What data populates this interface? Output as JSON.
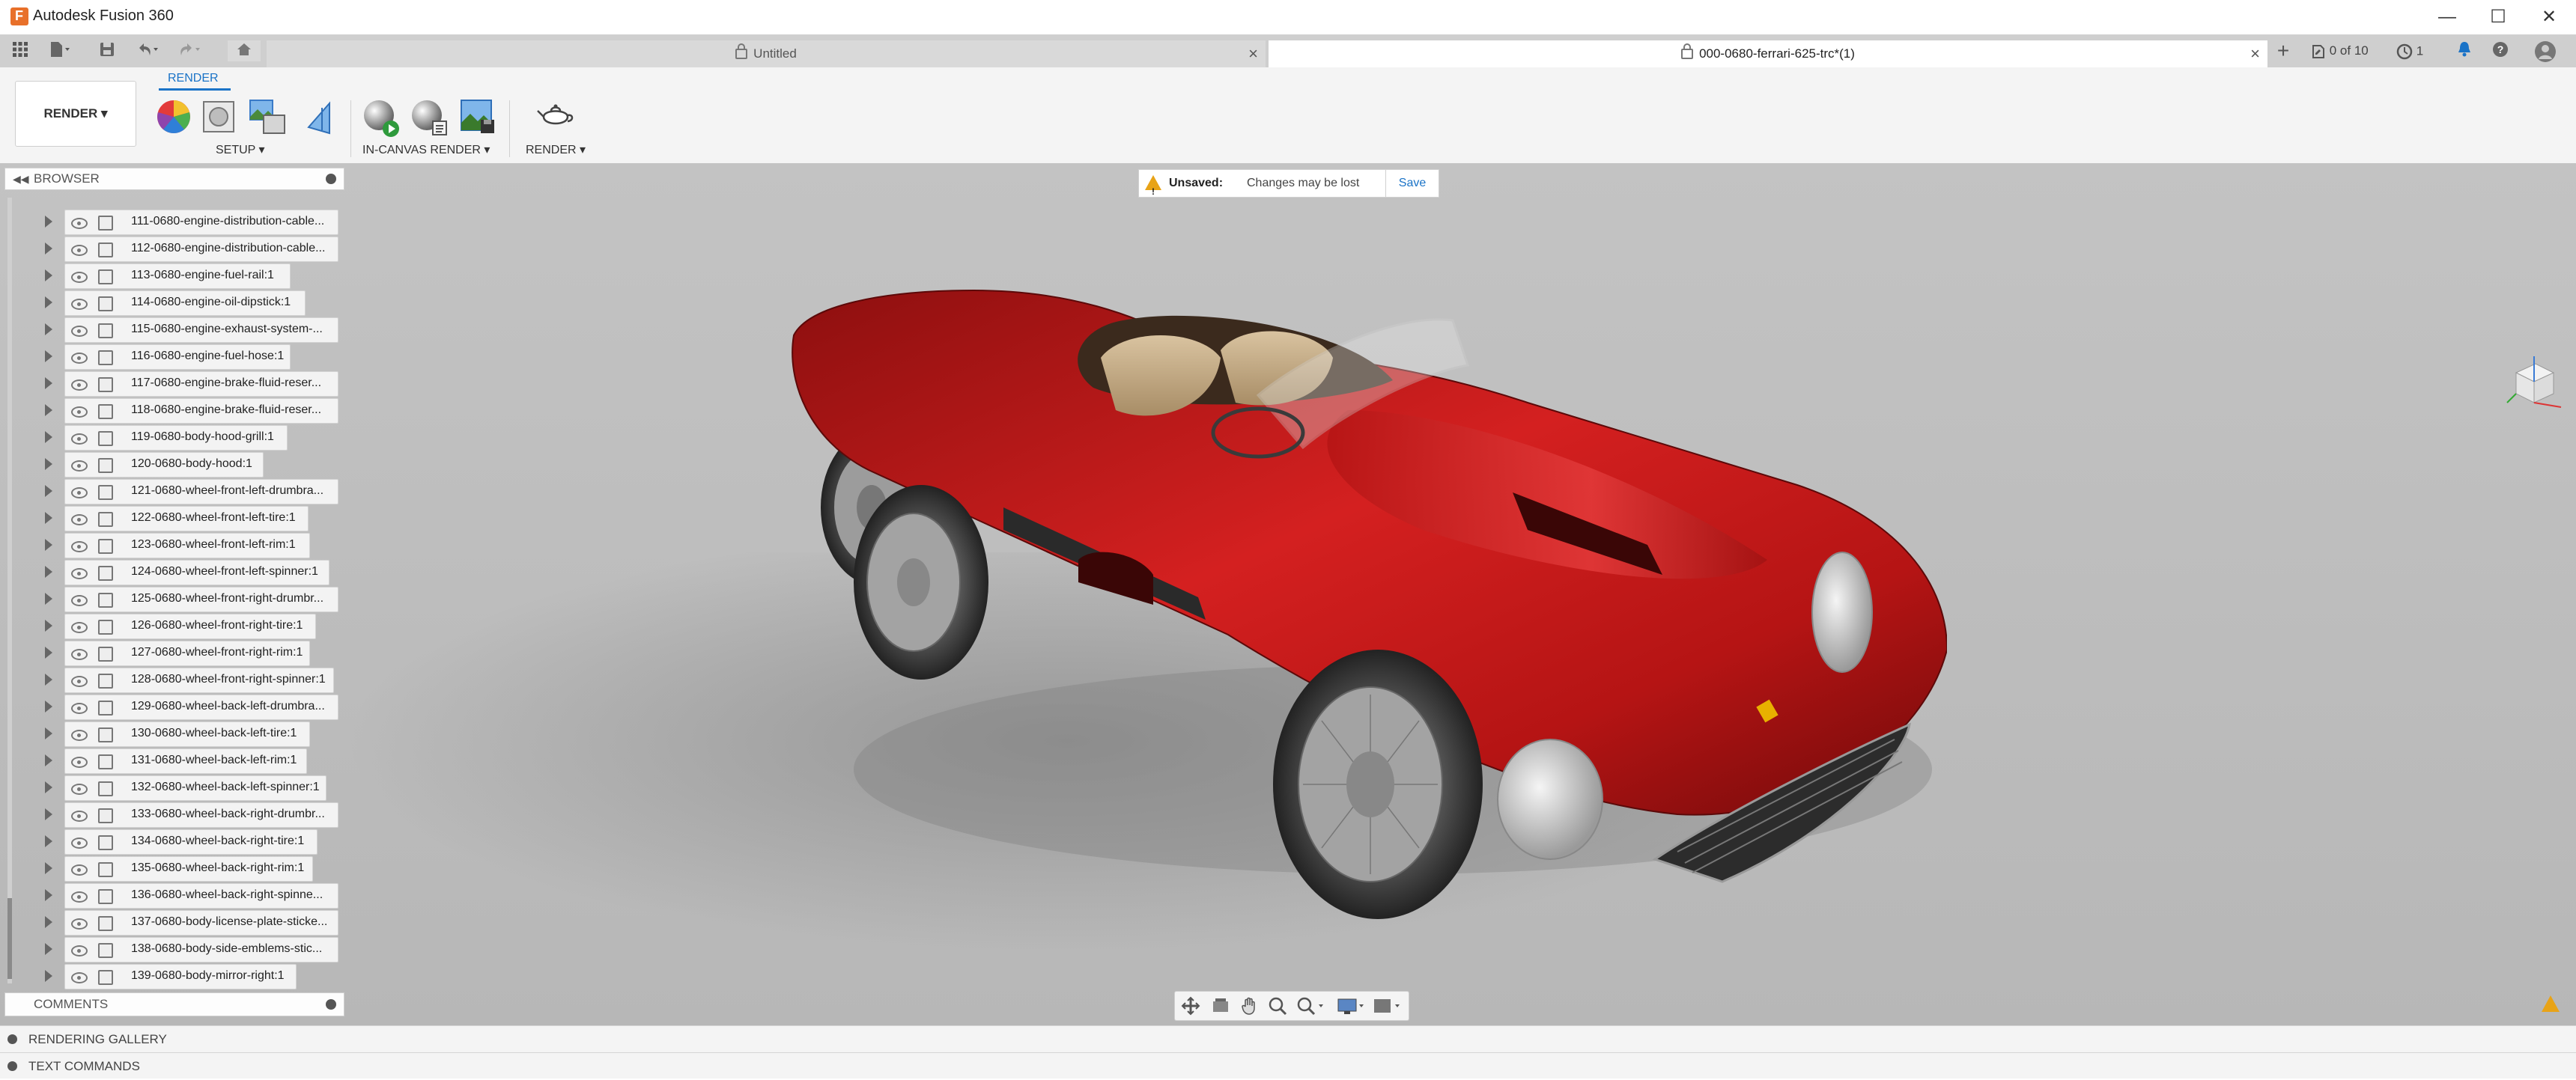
{
  "app": {
    "title": "Autodesk Fusion 360"
  },
  "window_controls": {
    "minimize": "—",
    "maximize": "☐",
    "close": "✕"
  },
  "tabs": [
    {
      "label": "Untitled"
    },
    {
      "label": "000-0680-ferrari-625-trc*(1)"
    }
  ],
  "tab_right": {
    "versions": "0 of 10",
    "jobs": "1"
  },
  "toolbar": {
    "workspace": "RENDER",
    "workspace_tab": "RENDER",
    "groups": {
      "setup": "SETUP",
      "in_canvas_render": "IN-CANVAS RENDER",
      "render": "RENDER"
    }
  },
  "browser": {
    "title": "BROWSER",
    "items": [
      "111-0680-engine-distribution-cable...",
      "112-0680-engine-distribution-cable...",
      "113-0680-engine-fuel-rail:1",
      "114-0680-engine-oil-dipstick:1",
      "115-0680-engine-exhaust-system-...",
      "116-0680-engine-fuel-hose:1",
      "117-0680-engine-brake-fluid-reser...",
      "118-0680-engine-brake-fluid-reser...",
      "119-0680-body-hood-grill:1",
      "120-0680-body-hood:1",
      "121-0680-wheel-front-left-drumbra...",
      "122-0680-wheel-front-left-tire:1",
      "123-0680-wheel-front-left-rim:1",
      "124-0680-wheel-front-left-spinner:1",
      "125-0680-wheel-front-right-drumbr...",
      "126-0680-wheel-front-right-tire:1",
      "127-0680-wheel-front-right-rim:1",
      "128-0680-wheel-front-right-spinner:1",
      "129-0680-wheel-back-left-drumbra...",
      "130-0680-wheel-back-left-tire:1",
      "131-0680-wheel-back-left-rim:1",
      "132-0680-wheel-back-left-spinner:1",
      "133-0680-wheel-back-right-drumbr...",
      "134-0680-wheel-back-right-tire:1",
      "135-0680-wheel-back-right-rim:1",
      "136-0680-wheel-back-right-spinne...",
      "137-0680-body-license-plate-sticke...",
      "138-0680-body-side-emblems-stic...",
      "139-0680-body-mirror-right:1"
    ]
  },
  "comments": {
    "title": "COMMENTS"
  },
  "unsaved": {
    "label": "Unsaved:",
    "message": "Changes may be lost",
    "save": "Save"
  },
  "bottom": {
    "gallery": "RENDERING GALLERY",
    "text_commands": "TEXT COMMANDS"
  },
  "colors": {
    "accent": "#1a73c7",
    "car_body": "#b51414",
    "warning": "#e8a317"
  }
}
